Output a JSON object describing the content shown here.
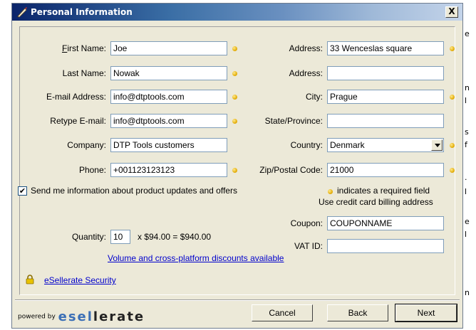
{
  "background_text": [
    "e",
    "n",
    "l",
    "s",
    "f",
    ".",
    "l",
    "e",
    "l",
    "n"
  ],
  "window": {
    "title": "Personal Information",
    "close_label": "X"
  },
  "left_fields": [
    {
      "label": "First Name:",
      "value": "Joe",
      "required": true
    },
    {
      "label": "Last Name:",
      "value": "Nowak",
      "required": true
    },
    {
      "label": "E-mail Address:",
      "value": "info@dtptools.com",
      "required": true
    },
    {
      "label": "Retype E-mail:",
      "value": "info@dtptools.com",
      "required": true
    },
    {
      "label": "Company:",
      "value": "DTP Tools customers",
      "required": false
    },
    {
      "label": "Phone:",
      "value": "+001123123123",
      "required": true
    }
  ],
  "right_fields": [
    {
      "label": "Address:",
      "value": "33 Wenceslas square",
      "required": true
    },
    {
      "label": "Address:",
      "value": "",
      "required": false
    },
    {
      "label": "City:",
      "value": "Prague",
      "required": true
    },
    {
      "label": "State/Province:",
      "value": "",
      "required": false
    },
    {
      "label": "Country:",
      "value": "Denmark",
      "required": true
    },
    {
      "label": "Zip/Postal Code:",
      "value": "21000",
      "required": true
    }
  ],
  "updates_checkbox": {
    "checked": true,
    "check_glyph": "✔",
    "label": "Send me information about product updates and offers"
  },
  "required_note": "indicates a required field",
  "billing_note": "Use credit card billing address",
  "quantity": {
    "label": "Quantity:",
    "value": "10",
    "price_text": "x $94.00 = $940.00"
  },
  "coupon": {
    "label": "Coupon:",
    "value": "COUPONNAME"
  },
  "vat": {
    "label": "VAT ID:",
    "value": ""
  },
  "discount_link": "Volume and cross-platform discounts available",
  "security_link": "eSellerate Security",
  "footer": {
    "powered_by": "powered by",
    "logo_a": "esel",
    "logo_b": "lerate"
  },
  "buttons": {
    "cancel": "Cancel",
    "back": "Back",
    "next": "Next"
  },
  "colors": {
    "title_start": "#0a246a",
    "title_end": "#c4d4ea",
    "dialog_bg": "#ece9d8",
    "required_dot": "#e0a800",
    "link": "#0000cc"
  }
}
